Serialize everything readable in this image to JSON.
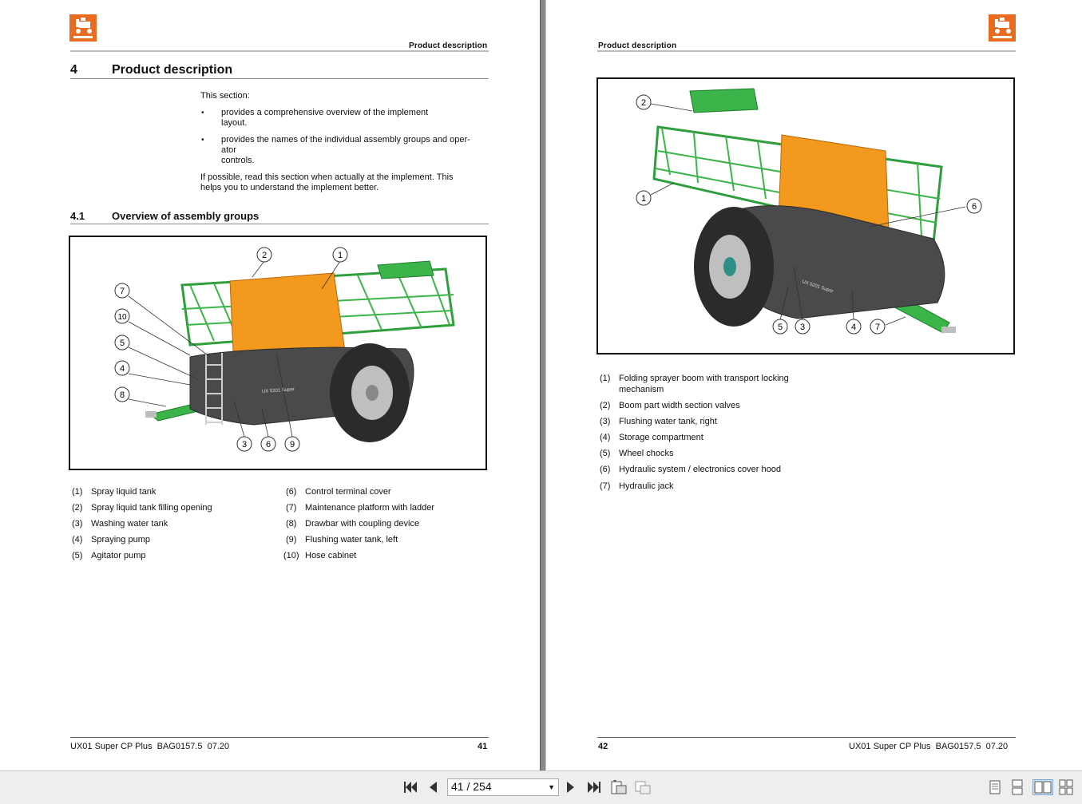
{
  "left_page": {
    "running_header": "Product description",
    "chapter_number": "4",
    "chapter_title": "Product description",
    "intro": "This section:",
    "bullets": [
      "provides a comprehensive overview of the implement layout.",
      [
        "provides the names of the individual assembly groups and oper-",
        "ator",
        "controls."
      ]
    ],
    "bullet1_lines": [
      "provides a comprehensive overview of the implement",
      "layout."
    ],
    "bullet2_lines": [
      "provides the names of the individual assembly groups and oper-",
      "ator",
      "controls."
    ],
    "note_lines": [
      "If possible, read this section when actually at the implement. This",
      "helps you to understand the implement better."
    ],
    "section_number": "4.1",
    "section_title": "Overview of assembly groups",
    "callouts": [
      "2",
      "1",
      "7",
      "10",
      "5",
      "4",
      "8",
      "3",
      "6",
      "9"
    ],
    "legend_left": [
      {
        "num": "(1)",
        "text": "Spray liquid tank"
      },
      {
        "num": "(2)",
        "text": "Spray liquid tank filling opening"
      },
      {
        "num": "(3)",
        "text": "Washing water tank"
      },
      {
        "num": "(4)",
        "text": "Spraying pump"
      },
      {
        "num": "(5)",
        "text": "Agitator pump"
      }
    ],
    "legend_right": [
      {
        "num": "(6)",
        "text": "Control terminal cover"
      },
      {
        "num": "(7)",
        "text": "Maintenance platform with ladder"
      },
      {
        "num": "(8)",
        "text": "Drawbar with coupling device"
      },
      {
        "num": "(9)",
        "text": "Flushing water tank, left"
      },
      {
        "num": "(10)",
        "text": "Hose cabinet"
      }
    ],
    "footer_text": "UX01 Super CP Plus  BAG0157.5  07.20",
    "page_number": "41"
  },
  "right_page": {
    "running_header": "Product description",
    "callouts": [
      "2",
      "1",
      "6",
      "5",
      "3",
      "4",
      "7"
    ],
    "legend": [
      {
        "num": "(1)",
        "text": "Folding sprayer boom with transport locking",
        "text2": "mechanism"
      },
      {
        "num": "(2)",
        "text": "Boom part width section valves"
      },
      {
        "num": "(3)",
        "text": "Flushing water tank, right"
      },
      {
        "num": "(4)",
        "text": "Storage compartment"
      },
      {
        "num": "(5)",
        "text": "Wheel chocks"
      },
      {
        "num": "(6)",
        "text": "Hydraulic system / electronics cover hood"
      },
      {
        "num": "(7)",
        "text": "Hydraulic jack"
      }
    ],
    "footer_text": "UX01 Super CP Plus  BAG0157.5  07.20",
    "page_number": "42"
  },
  "figure_labels": {
    "tank_text_left": "UX 5201 Super",
    "tank_text_right": "UX 5201 Super"
  },
  "toolbar": {
    "page_indicator": "41 / 254",
    "icons": [
      "first-page-icon",
      "prev-page-icon",
      "next-page-icon",
      "last-page-icon",
      "fit-page-icon",
      "fit-width-icon",
      "single-page-view-icon",
      "continuous-view-icon",
      "two-page-view-icon",
      "two-page-continuous-icon"
    ]
  },
  "colors": {
    "brand_orange": "#e86b1f",
    "boom_green": "#3bb54a",
    "tank_orange": "#f39a1e",
    "chassis_dark": "#4a4a4d"
  }
}
